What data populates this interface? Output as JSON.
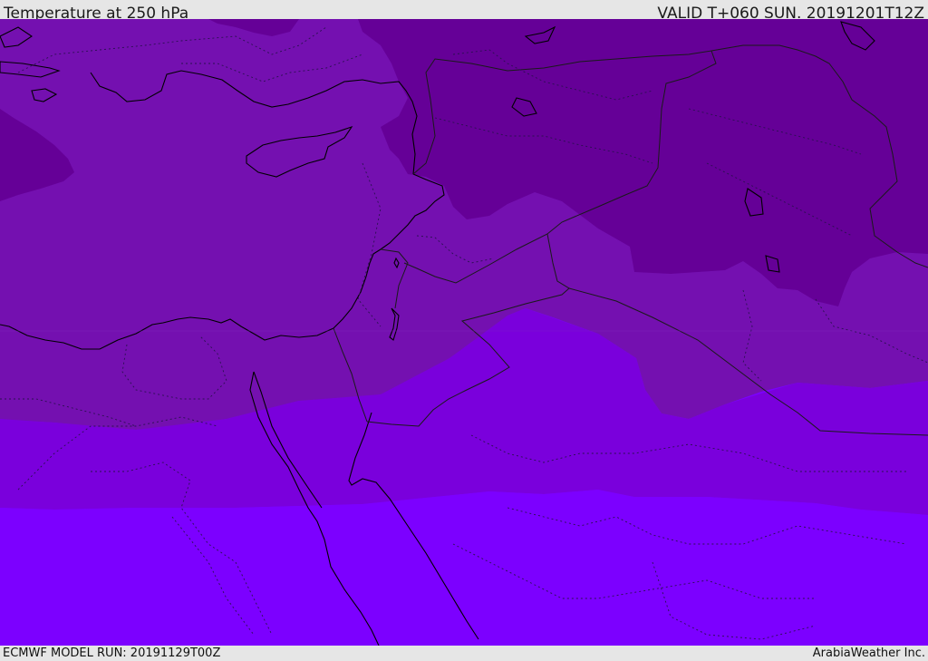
{
  "header": {
    "title": "Temperature at 250 hPa",
    "valid": "VALID T+060 SUN. 20191201T12Z"
  },
  "footer": {
    "model_run": "ECMWF MODEL RUN: 20191129T00Z",
    "credit": "ArabiaWeather Inc."
  },
  "map": {
    "region": "Eastern Mediterranean and Middle East",
    "variable": "temperature",
    "level": "250 hPa",
    "colors": {
      "band_coldest": "#650097",
      "band_cold": "#7410b0",
      "band_mid": "#7a00dc",
      "band_warm": "#7c00ff",
      "coastline": "#000000",
      "borders": "#222222"
    }
  }
}
